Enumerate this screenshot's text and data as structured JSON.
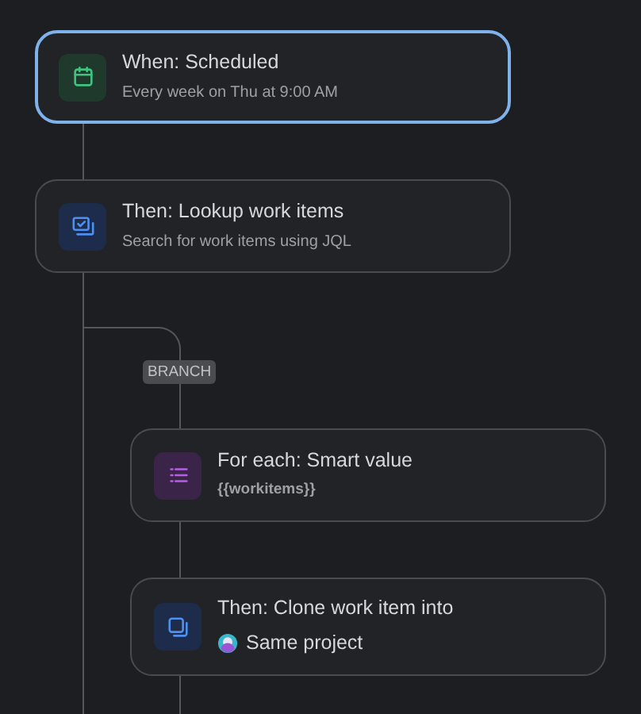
{
  "nodes": [
    {
      "kind": "schedule",
      "title": "When: Scheduled",
      "detail": "Every week on Thu at 9:00 AM",
      "selected": true
    },
    {
      "kind": "lookup",
      "title": "Then: Lookup work items",
      "detail": "Search for work items using JQL",
      "selected": false
    }
  ],
  "branch": {
    "label": "BRANCH",
    "children": [
      {
        "kind": "for-each",
        "title": "For each: Smart value",
        "detail": "{{workitems}}",
        "selected": false
      },
      {
        "kind": "clone",
        "title": "Then: Clone work item into",
        "detail": "Same project",
        "selected": false
      }
    ]
  }
}
